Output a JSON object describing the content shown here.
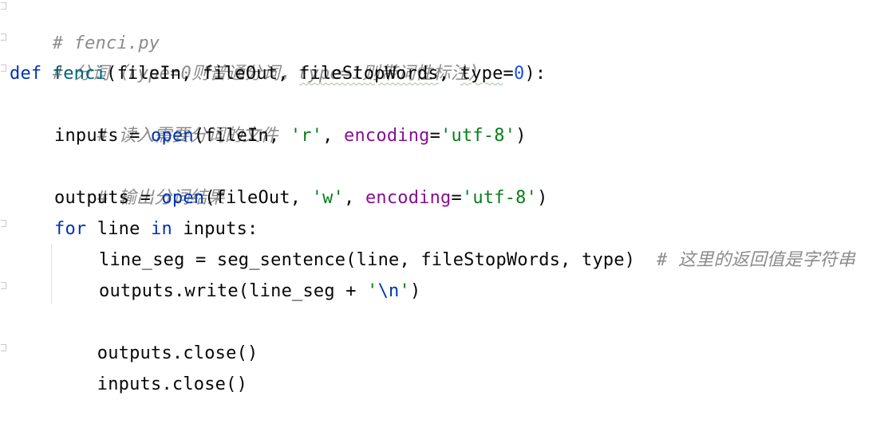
{
  "code": {
    "l1_comment": "# fenci.py",
    "l2_comment": "# 分词（type=0则普通分词，type=1则带词性标注）",
    "l3": {
      "kw_def": "def",
      "fn_name": "fenci",
      "open_paren": "(",
      "p1": "fileIn",
      "sep1": ", ",
      "p2": "fileOut",
      "sep2": ", ",
      "p3": "fileStopWords",
      "sep3": ", ",
      "p4": "type",
      "eq": "=",
      "default": "0",
      "close": "):"
    },
    "l4_comment": "# 读入需要分词的文件",
    "l5": {
      "var": "inputs",
      "assign": " = ",
      "builtin": "open",
      "args_start": "(fileIn, ",
      "mode": "'r'",
      "comma": ", ",
      "kwarg": "encoding",
      "eq": "=",
      "enc": "'utf-8'",
      "end": ")"
    },
    "l6_comment": "# 输出分词结果",
    "l7": {
      "var": "outputs",
      "assign": " = ",
      "builtin": "open",
      "args_start": "(fileOut, ",
      "mode": "'w'",
      "comma": ", ",
      "kwarg": "encoding",
      "eq": "=",
      "enc": "'utf-8'",
      "end": ")"
    },
    "l8": {
      "kw_for": "for",
      "mid1": " line ",
      "kw_in": "in",
      "mid2": " inputs:"
    },
    "l9": {
      "text": "line_seg = seg_sentence(line, fileStopWords, type)",
      "gap": "  ",
      "comment": "# 这里的返回值是字符串"
    },
    "l10": {
      "start": "outputs.write(line_seg + ",
      "q1": "'",
      "esc": "\\n",
      "q2": "'",
      "end": ")"
    },
    "l11": "outputs.close()",
    "l12": "inputs.close()"
  },
  "colors": {
    "keyword": "#0033b3",
    "function": "#00627a",
    "string": "#067d17",
    "number": "#1750eb",
    "keyword_arg": "#871094",
    "comment": "#8c8c8c"
  }
}
